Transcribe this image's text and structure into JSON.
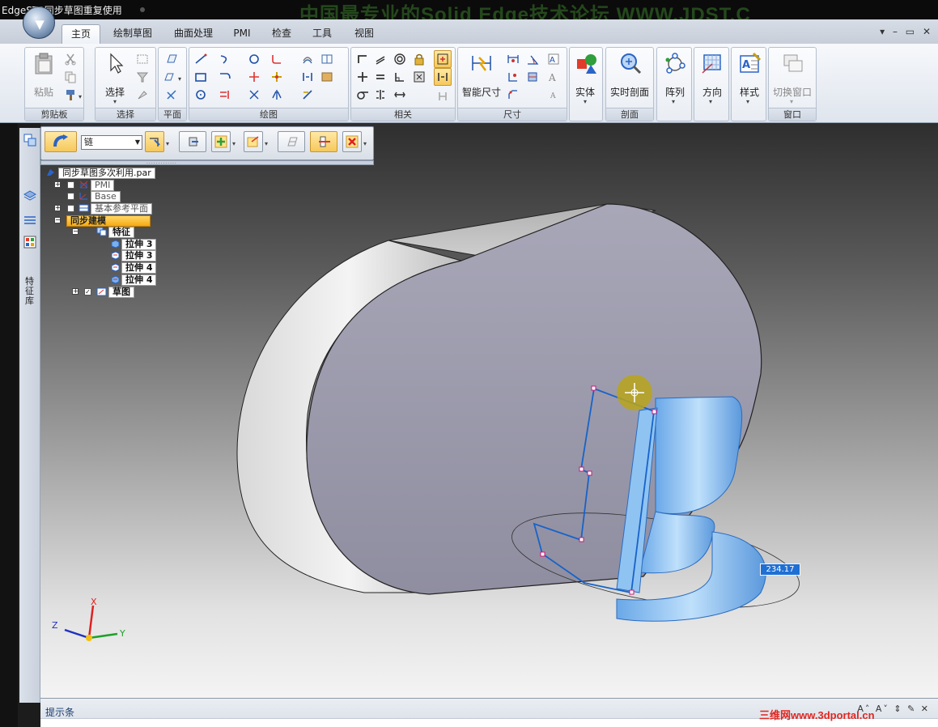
{
  "window": {
    "title": "EdgeST3同步草图重复使用",
    "title_watermark": "中国最专业的Solid Edge技术论坛  WWW.JDST.C"
  },
  "ribbon_tabs": [
    "主页",
    "绘制草图",
    "曲面处理",
    "PMI",
    "检查",
    "工具",
    "视图"
  ],
  "active_tab": "主页",
  "ribbon_groups": {
    "clipboard": {
      "label": "剪贴板",
      "paste": "粘贴"
    },
    "select": {
      "label": "选择",
      "select": "选择"
    },
    "plane": {
      "label": "平面"
    },
    "draw": {
      "label": "绘图"
    },
    "relate": {
      "label": "相关"
    },
    "dimension": {
      "label": "尺寸",
      "smart_dimension": "智能尺寸"
    },
    "solid": {
      "label": "实体"
    },
    "section": {
      "label": "剖面",
      "live_section": "实时剖面"
    },
    "pattern": {
      "label": "阵列"
    },
    "orient": {
      "label": "方向"
    },
    "style": {
      "label": "样式"
    },
    "window": {
      "label": "窗口",
      "switch_windows": "切换窗口"
    }
  },
  "command_bar": {
    "select_value": "链"
  },
  "side_tab_label": "特征库",
  "pathfinder": {
    "document": "同步草图多次利用.par",
    "nodes": {
      "pmi": "PMI",
      "base": "Base",
      "ref_planes": "基本参考平面",
      "sync_modeling": "同步建模",
      "features": "特征",
      "extrude_1": "拉伸 3",
      "extrude_2": "拉伸 3",
      "extrude_3": "拉伸 4",
      "extrude_4": "拉伸 4",
      "sketches": "草图"
    }
  },
  "triad": {
    "x": "X",
    "y": "Y",
    "z": "Z"
  },
  "dimension_value": "234.17",
  "prompt_bar": {
    "label": "提示条",
    "watermark": "三维网www.3dportal.cn"
  },
  "colors": {
    "highlight": "#f6a90f",
    "selection_blue": "#1e6fd4",
    "sketch_line": "#1763c9",
    "model_face": "#a09fb0"
  }
}
